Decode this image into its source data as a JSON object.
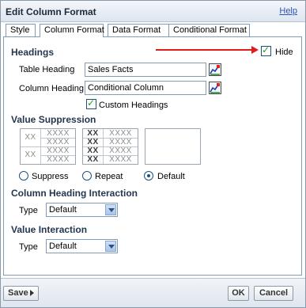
{
  "dialog": {
    "title": "Edit Column Format",
    "help": "Help"
  },
  "tabs": [
    {
      "label": "Style"
    },
    {
      "label": "Column Format",
      "active": true
    },
    {
      "label": "Data Format"
    },
    {
      "label": "Conditional Format"
    }
  ],
  "headings": {
    "section": "Headings",
    "hide_label": "Hide",
    "hide_checked": true,
    "table_heading_label": "Table Heading",
    "table_heading_value": "Sales Facts",
    "column_heading_label": "Column Heading",
    "column_heading_value": "Conditional Column",
    "custom_headings_label": "Custom Headings",
    "custom_headings_checked": true
  },
  "value_suppression": {
    "section": "Value Suppression",
    "sample_short": "XX",
    "sample_long": "XXXX",
    "options": [
      "Suppress",
      "Repeat",
      "Default"
    ],
    "selected": "Default"
  },
  "column_heading_interaction": {
    "section": "Column Heading Interaction",
    "type_label": "Type",
    "type_value": "Default"
  },
  "value_interaction": {
    "section": "Value Interaction",
    "type_label": "Type",
    "type_value": "Default"
  },
  "footer": {
    "save": "Save",
    "ok": "OK",
    "cancel": "Cancel"
  },
  "colors": {
    "annotation_arrow": "#e01b1b",
    "section_text": "#24374f",
    "checkmark": "#21a121"
  }
}
